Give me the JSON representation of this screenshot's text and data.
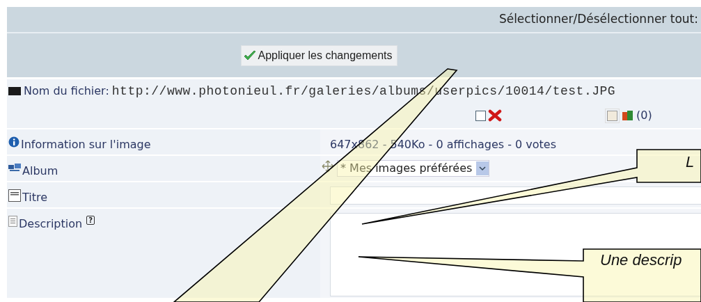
{
  "header": {
    "select_all_label": "Sélectionner/Désélectionner tout:"
  },
  "apply_button": {
    "label": "Appliquer les changements"
  },
  "file": {
    "label": "Nom du fichier:",
    "path": "http://www.photonieul.fr/galeries/albums/userpics/10014/test.JPG"
  },
  "actions": {
    "delete_checked": false,
    "approve_checked": false,
    "approve_count": "(0)"
  },
  "fields": [
    {
      "kind": "info",
      "label": "Information sur l'image",
      "value": "647x862 - 540Ko - 0 affichages - 0 votes"
    },
    {
      "kind": "select",
      "label": "Album",
      "value": "* Mes images préférées"
    },
    {
      "kind": "text",
      "label": "Titre"
    },
    {
      "kind": "textarea",
      "label": "Description",
      "help": "?"
    }
  ],
  "annotations": [
    {
      "text": "L"
    },
    {
      "text": "Une descrip"
    }
  ]
}
